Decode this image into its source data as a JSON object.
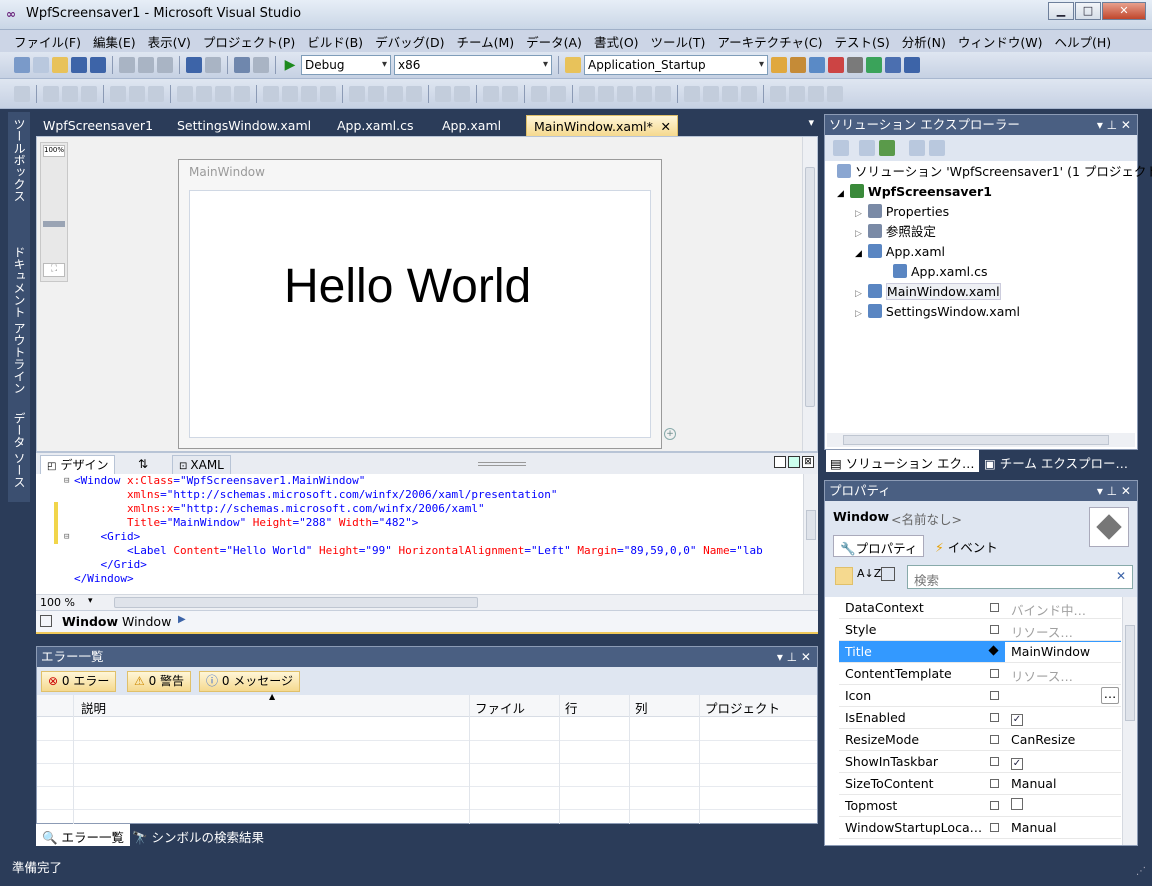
{
  "window": {
    "title": "WpfScreensaver1 - Microsoft Visual Studio",
    "icon": "vs-infinity-icon",
    "btn_min": "▁",
    "btn_max": "□",
    "btn_close": "✕"
  },
  "menu": [
    "ファイル(F)",
    "編集(E)",
    "表示(V)",
    "プロジェクト(P)",
    "ビルド(B)",
    "デバッグ(D)",
    "チーム(M)",
    "データ(A)",
    "書式(O)",
    "ツール(T)",
    "アーキテクチャ(C)",
    "テスト(S)",
    "分析(N)",
    "ウィンドウ(W)",
    "ヘルプ(H)"
  ],
  "toolbar": {
    "config": "Debug",
    "platform": "x86",
    "startup": "Application_Startup",
    "start_icon": "play-icon"
  },
  "left_strip": {
    "toolbox": "ツールボックス",
    "outline": "ドキュメント アウトライン",
    "datasources": "データ ソース"
  },
  "doc_tabs": [
    "WpfScreensaver1",
    "SettingsWindow.xaml",
    "App.xaml.cs",
    "App.xaml",
    "MainWindow.xaml*"
  ],
  "designer": {
    "zoom_label": "100%",
    "window_caption": "MainWindow",
    "label_content": "Hello World"
  },
  "split": {
    "design_tab": "デザイン",
    "swap": "⇅",
    "xaml_tab": "XAML"
  },
  "xaml": {
    "l1a": "<Window ",
    "l1b": "x:Class",
    "l1c": "=\"WpfScreensaver1.MainWindow\"",
    "l2a": "        xmlns",
    "l2b": "=\"http://schemas.microsoft.com/winfx/2006/xaml/presentation\"",
    "l3a": "        xmlns:x",
    "l3b": "=\"http://schemas.microsoft.com/winfx/2006/xaml\"",
    "l4a": "        Title",
    "l4b": "=\"MainWindow\"",
    "l4c": " Height",
    "l4d": "=\"288\"",
    "l4e": " Width",
    "l4f": "=\"482\"",
    "l4g": ">",
    "l5": "    <Grid>",
    "l6a": "        <Label ",
    "l6b": "Content",
    "l6c": "=\"Hello World\"",
    "l6d": " Height",
    "l6e": "=\"99\"",
    "l6f": " HorizontalAlignment",
    "l6g": "=\"Left\"",
    "l6h": " Margin",
    "l6i": "=\"89,59,0,0\"",
    "l6j": " Name",
    "l6k": "=\"lab",
    "l7": "    </Grid>",
    "l8": "</Window>"
  },
  "editor_zoom": "100 %",
  "breadcrumb": {
    "bold": "Window",
    "normal": "Window"
  },
  "error_list": {
    "title": "エラー一覧",
    "errors": "0 エラー",
    "warnings": "0 警告",
    "messages": "0 メッセージ",
    "columns": [
      "説明",
      "ファイル",
      "行",
      "列",
      "プロジェクト"
    ]
  },
  "bottom_tabs": [
    "エラー一覧",
    "シンボルの検索結果"
  ],
  "status": "準備完了",
  "solution_explorer": {
    "title": "ソリューション エクスプローラー",
    "solution": "ソリューション 'WpfScreensaver1' (1 プロジェクト",
    "project": "WpfScreensaver1",
    "items": [
      "Properties",
      "参照設定",
      "App.xaml",
      "App.xaml.cs",
      "MainWindow.xaml",
      "SettingsWindow.xaml"
    ],
    "tab_sol": "ソリューション エク…",
    "tab_team": "チーム エクスプロー…"
  },
  "properties": {
    "title": "プロパティ",
    "type": "Window",
    "name": "<名前なし>",
    "tab_props": "プロパティ",
    "tab_events": "イベント",
    "search_placeholder": "検索",
    "rows": [
      {
        "name": "DataContext",
        "value": "バインド中…",
        "muted": true
      },
      {
        "name": "Style",
        "value": "リソース…",
        "muted": true
      },
      {
        "name": "Title",
        "value": "MainWindow",
        "selected": true
      },
      {
        "name": "ContentTemplate",
        "value": "リソース…",
        "muted": true
      },
      {
        "name": "Icon",
        "value": ""
      },
      {
        "name": "IsEnabled",
        "value": "✓"
      },
      {
        "name": "ResizeMode",
        "value": "CanResize"
      },
      {
        "name": "ShowInTaskbar",
        "value": "✓"
      },
      {
        "name": "SizeToContent",
        "value": "Manual"
      },
      {
        "name": "Topmost",
        "value": ""
      },
      {
        "name": "WindowStartupLoca…",
        "value": "Manual"
      }
    ]
  },
  "colors": {
    "chrome": "#2b3c59",
    "active_tab": "#f5d98f",
    "selected": "#3399ff"
  }
}
